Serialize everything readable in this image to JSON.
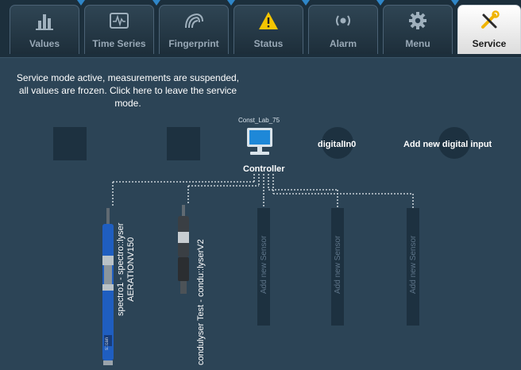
{
  "tabs": [
    {
      "id": "values",
      "label": "Values",
      "icon": "bar-chart-icon"
    },
    {
      "id": "time-series",
      "label": "Time Series",
      "icon": "time-series-icon"
    },
    {
      "id": "fingerprint",
      "label": "Fingerprint",
      "icon": "fingerprint-icon"
    },
    {
      "id": "status",
      "label": "Status",
      "icon": "warning-icon"
    },
    {
      "id": "alarm",
      "label": "Alarm",
      "icon": "alarm-icon"
    },
    {
      "id": "menu",
      "label": "Menu",
      "icon": "gear-icon"
    },
    {
      "id": "service",
      "label": "Service",
      "icon": "tools-icon",
      "active": true
    }
  ],
  "service_notice": "Service mode active, measurements are suspended, all values are frozen. Click here to leave the service mode.",
  "controller": {
    "name": "Const_Lab_75",
    "label": "Controller"
  },
  "digital_inputs": [
    "digitalIn0",
    "Add new digital input"
  ],
  "sensors": [
    {
      "line1": "spectro1 - spectro::lyser",
      "line2": "AERATIONV150",
      "brand": "s::can"
    },
    {
      "line1": "condulyser Test - condu::lyserV2",
      "line2": ""
    }
  ],
  "add_sensor_label": "Add new Sensor",
  "colors": {
    "background": "#2c4456",
    "tabbar": "#1c2f3c",
    "slot": "#1d3140",
    "connector": "#c7d0d6",
    "accent": "#2f86c8",
    "warning": "#f5c500",
    "service_icon": "#f0b400",
    "probe_blue": "#1f5ec0"
  }
}
